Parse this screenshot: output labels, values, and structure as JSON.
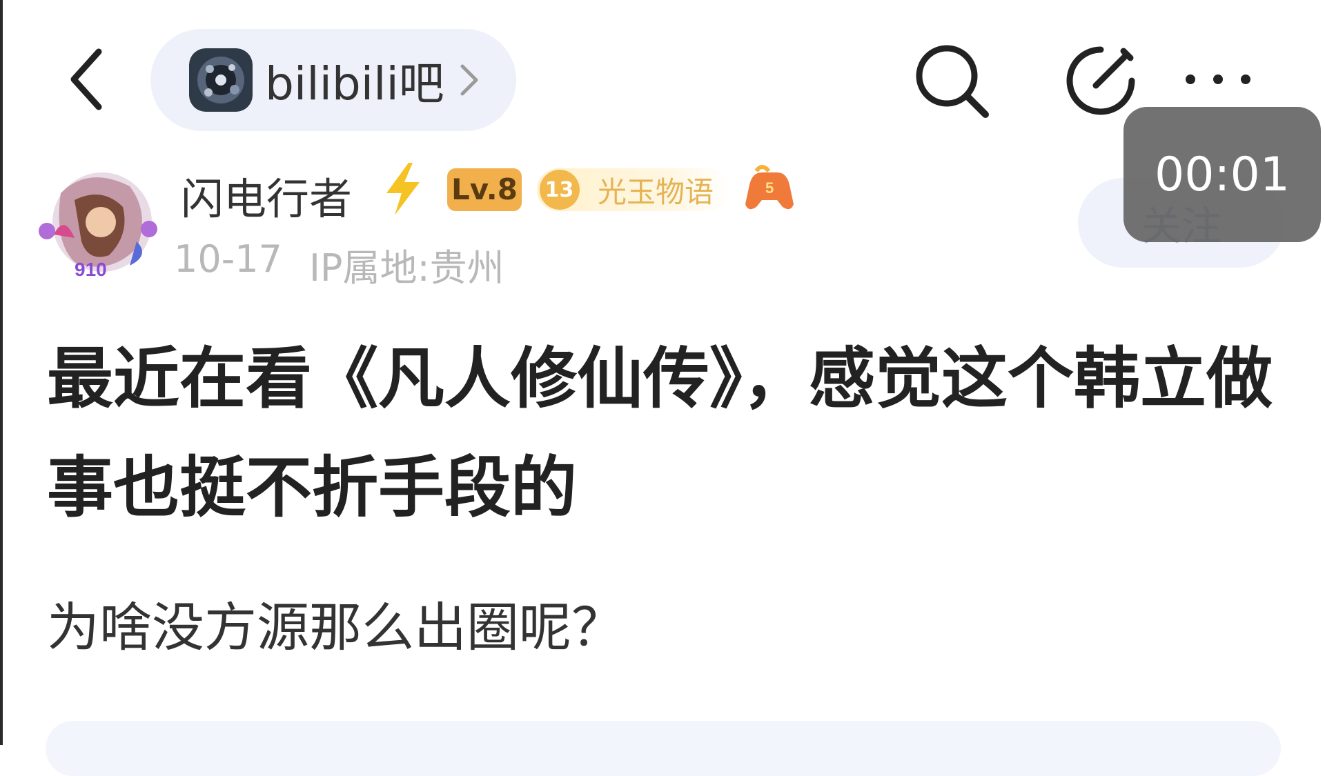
{
  "header": {
    "back_icon": "chevron-left-icon",
    "forum_name": "bilibili吧",
    "forum_chevron_icon": "chevron-right-icon",
    "search_icon": "search-icon",
    "edit_icon": "edit-icon",
    "more_icon": "more-horizontal-icon"
  },
  "author": {
    "name": "闪电行者",
    "name_emoji_icon": "lightning-icon",
    "level_badge": "Lv.8",
    "fan_badge_level": "13",
    "fan_badge_name": "光玉物语",
    "game_badge_icon": "gamepad-icon",
    "date": "10-17",
    "ip_location": "IP属地:贵州",
    "follow_label": "关注"
  },
  "overlay": {
    "timer": "00:01"
  },
  "post": {
    "title": "最近在看《凡人修仙传》，感觉这个韩立做事也挺不折手段的",
    "body": "为啥没方源那么出圈呢？"
  },
  "colors": {
    "level_badge": "#f1b04c",
    "fan_badge": "#f2b84b",
    "pill_background": "#eef1fa",
    "secondary_text": "#b8b8b8"
  }
}
